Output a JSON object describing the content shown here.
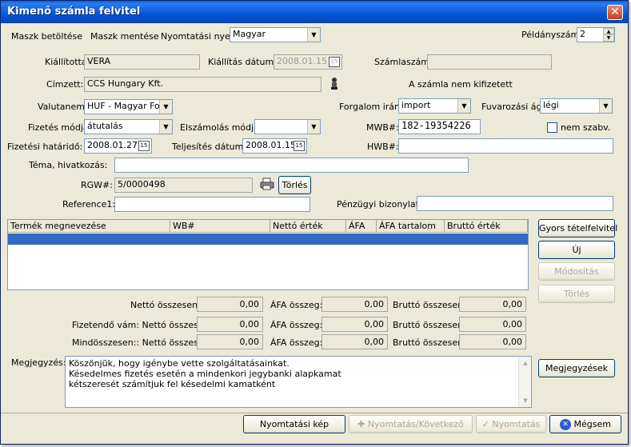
{
  "window": {
    "title": "Kimenő számla felvitel"
  },
  "toolbar": {
    "load_mask": "Maszk betöltése",
    "save_mask": "Maszk mentése",
    "print_lang_label": "Nyomtatási nyelv:",
    "print_lang_value": "Magyar",
    "copies_label": "Példányszám:",
    "copies_value": "2"
  },
  "form": {
    "issuer_label": "Kiállította:",
    "issuer_value": "VERA",
    "issue_date_label": "Kiállítás dátuma:",
    "issue_date_value": "2008.01.15",
    "invoice_no_label": "Számlaszám:",
    "invoice_no_value": "",
    "recipient_label": "Címzett:",
    "recipient_value": "CCS Hungary Kft.",
    "unpaid_text": "A számla nem kifizetett",
    "currency_label": "Valutanem:",
    "currency_value": "HUF - Magyar Forint",
    "traffic_dir_label": "Forgalom irány:",
    "traffic_dir_value": "import",
    "transport_label": "Fuvarozási ág:",
    "transport_value": "légi",
    "payment_method_label": "Fizetés módja:",
    "payment_method_value": "átutalás",
    "settlement_label": "Elszámolás módja:",
    "settlement_value": "",
    "mwb_label": "MWB#:",
    "mwb_value": "182-19354226",
    "nonstd_label": "nem szabv.",
    "due_date_label": "Fizetési határidő:",
    "due_date_value": "2008.01.27",
    "perf_date_label": "Teljesítés dátuma:",
    "perf_date_value": "2008.01.15",
    "hwb_label": "HWB#:",
    "hwb_value": "",
    "subject_label": "Téma, hivatkozás:",
    "subject_value": "",
    "rgw_label": "RGW#:",
    "rgw_value": "5/0000498",
    "rgw_delete": "Törlés",
    "reference_label": "Reference1:",
    "reference_value": "",
    "fin_doc_label": "Pénzügyi bizonylat#:",
    "fin_doc_value": ""
  },
  "grid": {
    "columns": [
      "Termék megnevezése",
      "WB#",
      "Nettó érték",
      "ÁFA",
      "ÁFA tartalom",
      "Bruttó érték"
    ]
  },
  "side_buttons": {
    "quick": "Gyors tételfelvitel",
    "new": "Új",
    "modify": "Módosítás",
    "delete": "Törlés",
    "notes": "Megjegyzések"
  },
  "totals": {
    "net_total_label": "Nettó összesen:",
    "vat_label": "ÁFA összeg:",
    "gross_total_label": "Bruttó összesen:",
    "duty_net_label": "Fizetendő vám: Nettó összesen:",
    "grand_net_label": "Mindösszesen:: Nettó összesen:",
    "r1": [
      "0,00",
      "0,00",
      "0,00"
    ],
    "r2": [
      "0,00",
      "0,00",
      "0,00"
    ],
    "r3": [
      "0,00",
      "0,00",
      "0,00"
    ]
  },
  "notes": {
    "label": "Megjegyzés:",
    "line1": "Köszönjük, hogy igénybe vette szolgáltatásainkat.",
    "line2": "Késedelmes fizetés esetén a mindenkori jegybanki alapkamat",
    "line3": "kétszeresét számítjuk fel késedelmi kamatként"
  },
  "bottom": {
    "preview": "Nyomtatási kép",
    "print_next": "Nyomtatás/Következő",
    "print": "Nyomtatás",
    "cancel": "Mégsem"
  }
}
